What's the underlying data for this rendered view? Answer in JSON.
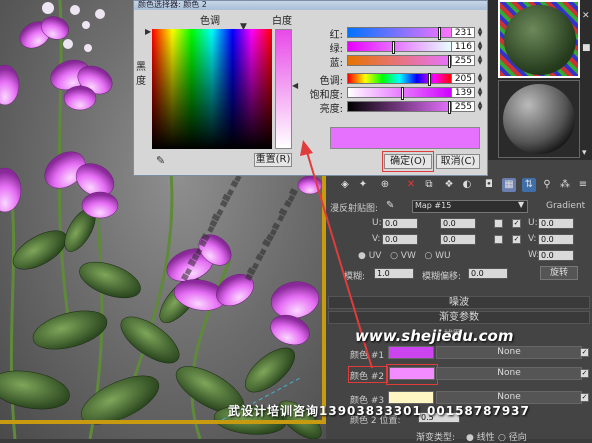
{
  "dialog": {
    "title": "颜色选择器: 颜色 2",
    "hue_label": "色调",
    "white_label": "白度",
    "black_label": "黑度",
    "reset_label": "重置(R)",
    "ok_label": "确定(O)",
    "cancel_label": "取消(C)",
    "new_color": "#e771ff",
    "sliders": [
      {
        "label": "红:",
        "value": "231",
        "fraction": 0.906,
        "gradient": "linear-gradient(to right,#0073ff,#ff73ff)"
      },
      {
        "label": "绿:",
        "value": "116",
        "fraction": 0.455,
        "gradient": "linear-gradient(to right,#e700ff,#e7ffff)"
      },
      {
        "label": "蓝:",
        "value": "255",
        "fraction": 1.0,
        "gradient": "linear-gradient(to right,#e77300,#e773ff)"
      },
      {
        "label": "色调:",
        "value": "205",
        "fraction": 0.804,
        "gradient": "linear-gradient(to right,#f00,#ff0,#0f0,#0ff,#00f,#f0f,#f00)"
      },
      {
        "label": "饱和度:",
        "value": "139",
        "fraction": 0.545,
        "gradient": "linear-gradient(to right,#fff,#d000ff)"
      },
      {
        "label": "亮度:",
        "value": "255",
        "fraction": 1.0,
        "gradient": "linear-gradient(to right,#000,#e771ff)"
      }
    ]
  },
  "panel": {
    "map_label": "漫反射贴图:",
    "map_value": "Map #15",
    "gradient_label": "Gradient",
    "u_label": "U:",
    "v_label": "V:",
    "w_label": "W:",
    "u_value": "0.0",
    "v_value": "0.0",
    "w_value": "0.0",
    "u_value2": "0.0",
    "v_value2": "0.0",
    "radio_uv": "UV",
    "radio_vw": "VW",
    "radio_wu": "WU",
    "blur_label": "模糊:",
    "blur_value": "1.0",
    "blur_offset_label": "模糊偏移:",
    "blur_offset_value": "0.0",
    "rotate_label": "旋转",
    "noise_rollout": "噪波",
    "gradient_params_rollout": "渐变参数",
    "partial_heading": "扰图",
    "color_rows": [
      {
        "label": "颜色 #1",
        "color": "#cc44f0",
        "map": "None"
      },
      {
        "label": "颜色 #2",
        "color": "#f28cff",
        "map": "None"
      },
      {
        "label": "颜色 #3",
        "color": "#fff6c4",
        "map": "None"
      }
    ],
    "color2_pos_label": "颜色 2 位置:",
    "color2_pos_value": "0.5",
    "gradient_type_label": "渐变类型:",
    "gradient_type_linear": "线性",
    "gradient_type_radial": "径向"
  },
  "watermark": "www.shejiedu.com",
  "footer_ad": "武设计培训咨询13903833301 00158787937"
}
